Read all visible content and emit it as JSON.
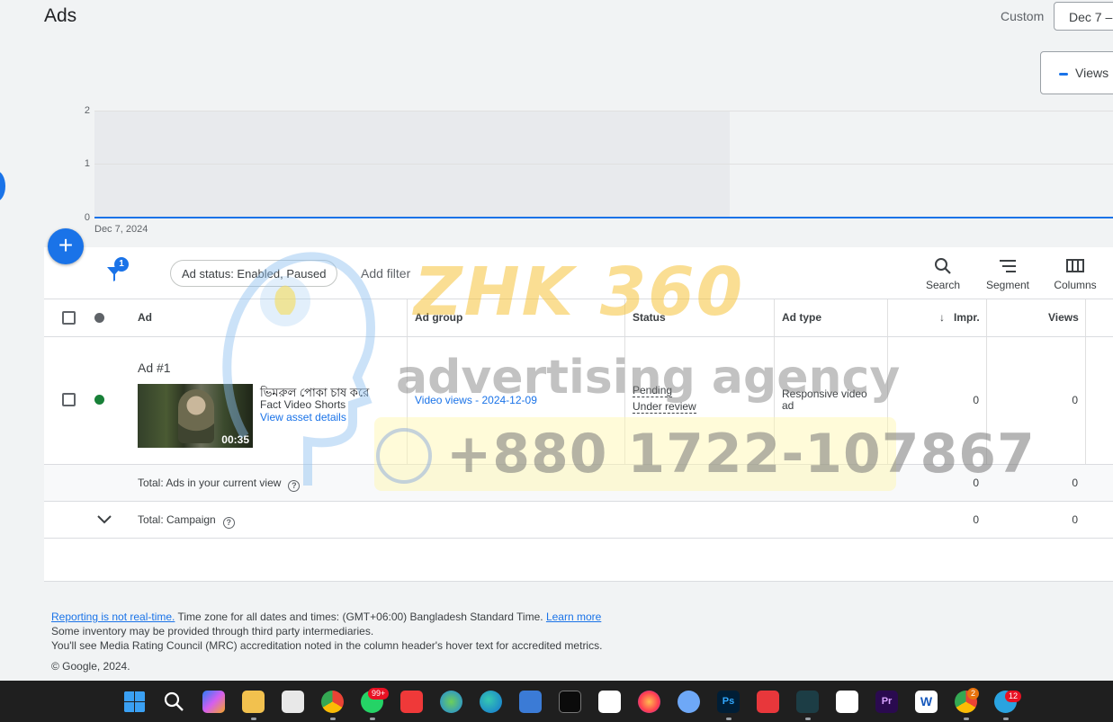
{
  "page": {
    "title": "Ads"
  },
  "date_range": {
    "label": "Custom",
    "value": "Dec 7 –"
  },
  "chart_toggle": {
    "metric_label": "Views",
    "metric_color": "#1a73e8"
  },
  "chart_data": {
    "type": "line",
    "x": [
      "Dec 7, 2024"
    ],
    "series": [
      {
        "name": "Views",
        "values": [
          0
        ]
      }
    ],
    "ylim": [
      0,
      2
    ],
    "yticks": [
      "0",
      "1",
      "2"
    ],
    "xticks": [
      "Dec 7, 2024"
    ],
    "grid": true
  },
  "toolbar": {
    "filter_count": "1",
    "filter_chip": "Ad status: Enabled, Paused",
    "add_filter": "Add filter",
    "search": "Search",
    "segment": "Segment",
    "columns": "Columns"
  },
  "table": {
    "headers": {
      "ad": "Ad",
      "ad_group": "Ad group",
      "status": "Status",
      "ad_type": "Ad type",
      "impr": "Impr.",
      "views": "Views"
    },
    "rows": [
      {
        "ad_name": "Ad #1",
        "headline": "ভিমরুল পোকা চাষ করে",
        "description": "Fact Video Shorts",
        "asset_link": "View asset details",
        "duration": "00:35",
        "ad_group": "Video views - 2024-12-09",
        "status_line1": "Pending",
        "status_line2": "Under review",
        "ad_type": "Responsive video ad",
        "impr": "0",
        "views": "0",
        "status_color": "#188038"
      }
    ],
    "totals": [
      {
        "label": "Total: Ads in your current view",
        "impr": "0",
        "views": "0"
      },
      {
        "label": "Total: Campaign",
        "impr": "0",
        "views": "0"
      }
    ]
  },
  "watermark": {
    "brand": "ZHK 360",
    "tagline": "advertising agency",
    "phone": "+880 1722-107867"
  },
  "footer": {
    "realtime_link": "Reporting is not real-time.",
    "timezone_text": " Time zone for all dates and times: (GMT+06:00) Bangladesh Standard Time. ",
    "learn_more": "Learn more",
    "line2": "Some inventory may be provided through third party intermediaries.",
    "line3": "You'll see Media Rating Council (MRC) accreditation noted in the column header's hover text for accredited metrics.",
    "copyright": "© Google, 2024."
  },
  "taskbar": {
    "whatsapp_badge": "99+",
    "chrome2_badge": "2",
    "telegram_badge": "12"
  }
}
